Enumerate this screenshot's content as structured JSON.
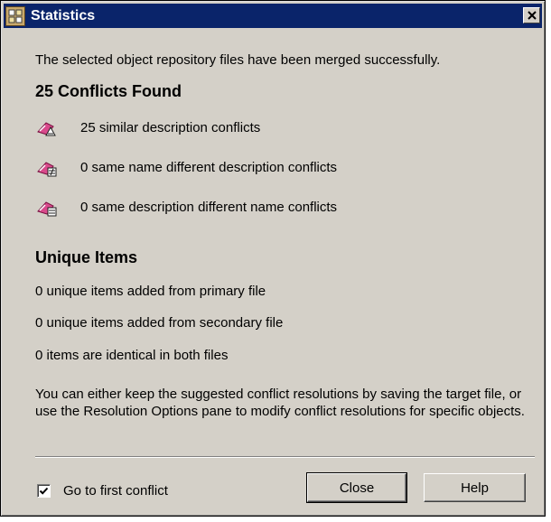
{
  "window": {
    "title": "Statistics",
    "close_glyph": "✕"
  },
  "merge_message": "The selected object repository files have been merged successfully.",
  "conflicts": {
    "heading": "25 Conflicts Found",
    "items": [
      {
        "label": "25 similar description conflicts",
        "icon": "similar-description-conflict-icon"
      },
      {
        "label": "0 same name different description conflicts",
        "icon": "same-name-conflict-icon"
      },
      {
        "label": "0 same description different name conflicts",
        "icon": "same-description-conflict-icon"
      }
    ]
  },
  "unique": {
    "heading": "Unique Items",
    "items": [
      "0 unique items added from primary file",
      "0 unique items added from secondary file",
      "0 items are identical in both files"
    ]
  },
  "info_text": "You can either keep the suggested conflict resolutions by saving the target file, or use the Resolution Options pane to modify conflict resolutions for specific objects.",
  "footer": {
    "checkbox_label": "Go to first conflict",
    "checkbox_checked": true,
    "close_label": "Close",
    "help_label": "Help"
  },
  "colors": {
    "titlebar": "#0a246a",
    "face": "#d4d0c8",
    "icon_accent": "#c0286e"
  }
}
